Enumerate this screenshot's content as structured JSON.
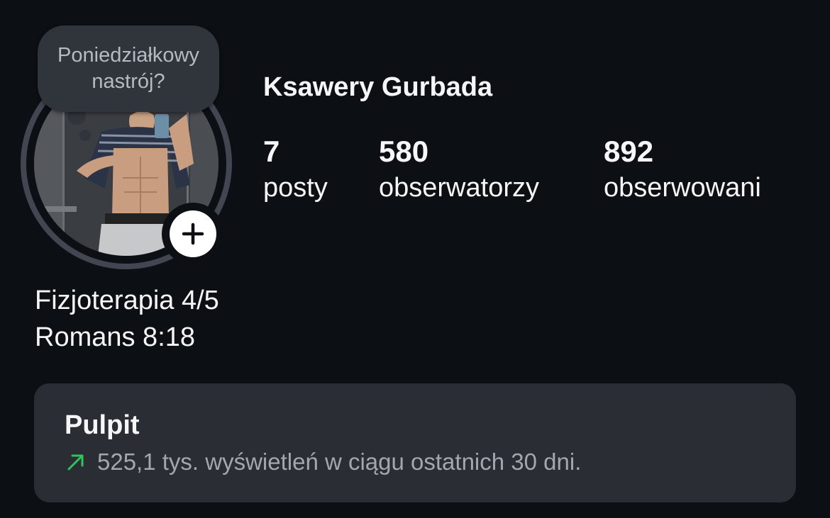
{
  "note": {
    "text": "Poniedziałkowy nastrój?"
  },
  "profile": {
    "name": "Ksawery Gurbada",
    "avatar_icon": "profile-photo",
    "add_icon": "plus-icon"
  },
  "stats": [
    {
      "count": "7",
      "label": "posty"
    },
    {
      "count": "580",
      "label": "obserwatorzy"
    },
    {
      "count": "892",
      "label": "obserwowani"
    }
  ],
  "bio": {
    "lines": [
      "Fizjoterapia 4/5",
      "Romans 8:18"
    ]
  },
  "dashboard": {
    "title": "Pulpit",
    "stat_text": "525,1 tys. wyświetleń w ciągu ostatnich 30 dni.",
    "trend_icon": "arrow-up-right-icon",
    "trend_color": "#2fc35a"
  },
  "colors": {
    "background": "#0c0f14",
    "card": "#2a2d33",
    "bubble": "#30343b",
    "ring": "#414650"
  }
}
